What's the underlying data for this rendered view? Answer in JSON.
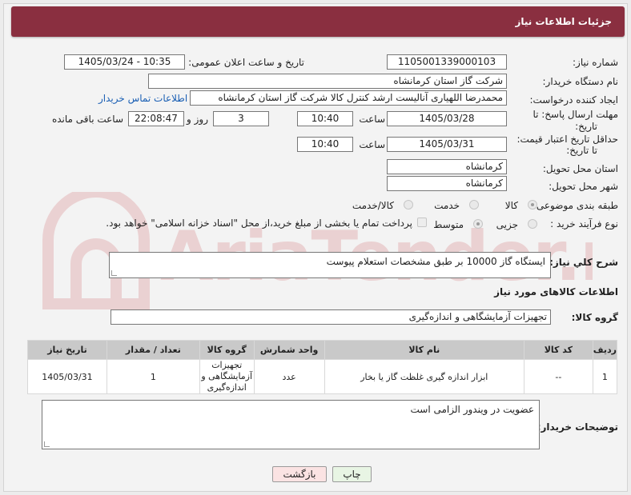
{
  "header": {
    "title": "جزئیات اطلاعات نیاز"
  },
  "form": {
    "need_number_label": "شماره نیاز:",
    "need_number": "1105001339000103",
    "announce_label": "تاریخ و ساعت اعلان عمومی:",
    "announce_value": "1405/03/24 - 10:35",
    "buyer_org_label": "نام دستگاه خریدار:",
    "buyer_org": "شرکت گاز استان کرمانشاه",
    "creator_label": "ایجاد کننده درخواست:",
    "creator": "محمدرضا اللهیاری آنالیست ارشد کنترل کالا شرکت گاز استان کرمانشاه",
    "contact_link": "اطلاعات تماس خریدار",
    "reply_deadline_label_1": "مهلت ارسال پاسخ: تا",
    "reply_deadline_label_2": "تاریخ:",
    "reply_date": "1405/03/28",
    "time_label": "ساعت",
    "reply_time": "10:40",
    "days_value": "3",
    "days_label": "روز و",
    "remaining_time": "22:08:47",
    "remaining_label": "ساعت باقی مانده",
    "price_validity_label_1": "حداقل تاریخ اعتبار قیمت:",
    "price_validity_label_2": "تا تاریخ:",
    "price_date": "1405/03/31",
    "price_time": "10:40",
    "province_label": "استان محل تحویل:",
    "province": "کرمانشاه",
    "city_label": "شهر محل تحویل:",
    "city": "کرمانشاه",
    "category_label": "طبقه بندی موضوعی:",
    "category_options": [
      "کالا",
      "خدمت",
      "کالا/خدمت"
    ],
    "process_label": "نوع فرآیند خرید :",
    "process_options": [
      "جزیی",
      "متوسط"
    ],
    "payment_note": "پرداخت تمام یا بخشی از مبلغ خرید،از محل \"اسناد خزانه اسلامی\" خواهد بود."
  },
  "description": {
    "label": "شرح كلي نياز:",
    "text": "ایستگاه گاز 10000 بر طبق مشخصات استعلام پیوست"
  },
  "goods": {
    "section_title": "اطلاعات کالاهای مورد نیاز",
    "group_label": "گروه کالا:",
    "group_value": "تجهیزات آزمایشگاهی و اندازه‌گیری",
    "columns": [
      "ردیف",
      "کد کالا",
      "نام کالا",
      "واحد شمارش",
      "گروه کالا",
      "تعداد / مقدار",
      "تاریخ نیاز"
    ],
    "rows": [
      {
        "row": "1",
        "code": "--",
        "name": "ابزار اندازه گیری غلظت گاز یا بخار",
        "unit": "عدد",
        "group": "تجهیزات آزمایشگاهی و اندازه‌گیری",
        "qty": "1",
        "date": "1405/03/31"
      }
    ]
  },
  "buyer_notes": {
    "label": "توضیحات خریدار:",
    "text": "عضویت در ویندور الزامی است"
  },
  "buttons": {
    "print": "چاپ",
    "back": "بازگشت"
  },
  "watermark": {
    "text": "AriaTender.net"
  },
  "colors": {
    "title_bg": "#8a2f40",
    "link": "#1a5fb4",
    "print_bg": "#e8f5e4",
    "back_bg": "#fbe3e3",
    "watermark": "#c0282d"
  }
}
